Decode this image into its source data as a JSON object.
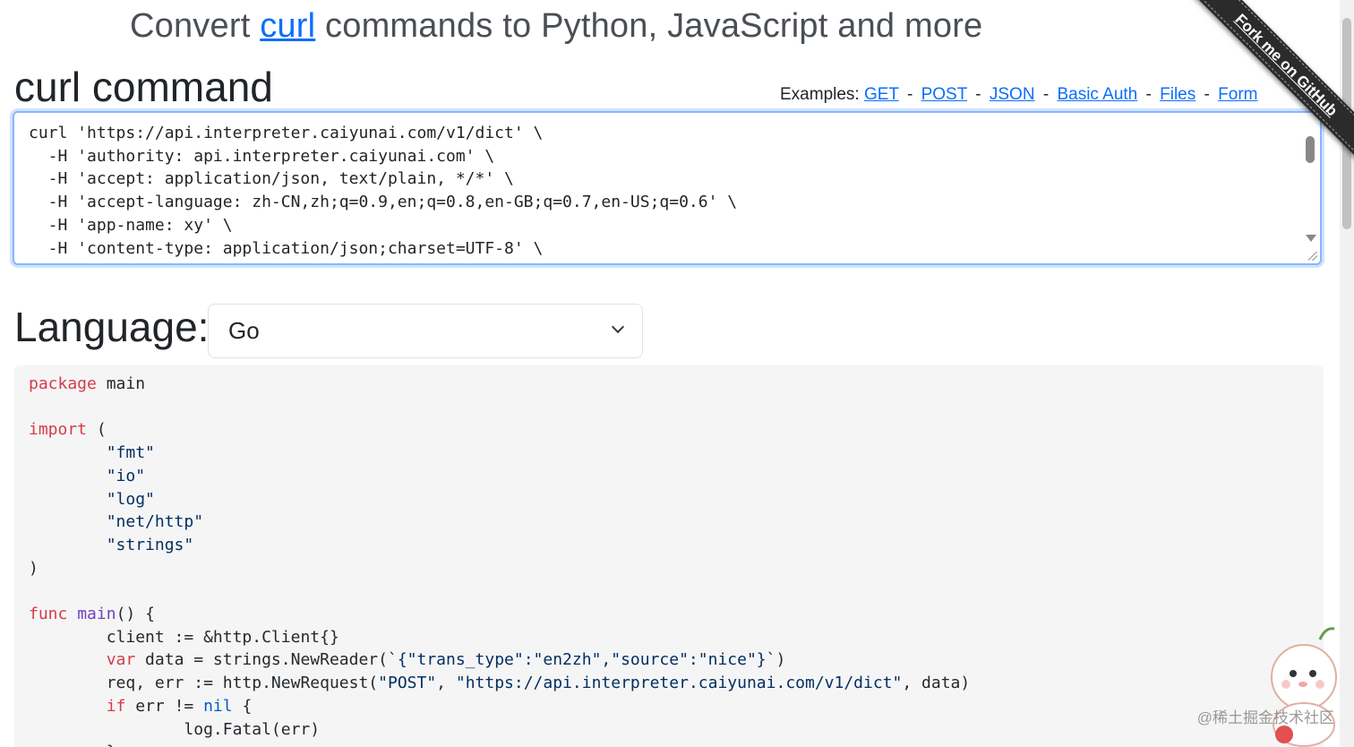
{
  "header": {
    "title_before": "Convert",
    "title_link": "curl",
    "title_after": "commands to Python, JavaScript and more"
  },
  "curl_section": {
    "heading": "curl command",
    "examples_label": "Examples:",
    "examples": [
      "GET",
      "POST",
      "JSON",
      "Basic Auth",
      "Files",
      "Form"
    ],
    "separator": "-",
    "command": "curl 'https://api.interpreter.caiyunai.com/v1/dict' \\\n  -H 'authority: api.interpreter.caiyunai.com' \\\n  -H 'accept: application/json, text/plain, */*' \\\n  -H 'accept-language: zh-CN,zh;q=0.9,en;q=0.8,en-GB;q=0.7,en-US;q=0.6' \\\n  -H 'app-name: xy' \\\n  -H 'content-type: application/json;charset=UTF-8' \\"
  },
  "language": {
    "label": "Language:",
    "selected": "Go"
  },
  "code": {
    "kw_package": "package",
    "pkg_name": " main",
    "kw_import": "import",
    "import_open": " (",
    "imports": [
      "\"fmt\"",
      "\"io\"",
      "\"log\"",
      "\"net/http\"",
      "\"strings\""
    ],
    "close_paren": ")",
    "kw_func": "func",
    "fn_main": "main",
    "main_rest": "() {",
    "line_client": "client := &http.Client{}",
    "kw_var": "var",
    "var_rest_a": " data = strings.NewReader(`",
    "raw_string": "{\"trans_type\":\"en2zh\",\"source\":\"nice\"}",
    "var_rest_b": "`)",
    "req_a": "req, err := http.NewRequest(",
    "req_method": "\"POST\"",
    "req_comma": ", ",
    "req_url": "\"https://api.interpreter.caiyunai.com/v1/dict\"",
    "req_b": ", data)",
    "kw_if": "if",
    "if_mid": " err != ",
    "lit_nil": "nil",
    "if_end": " {",
    "fatal": "log.Fatal(err)",
    "close_brace": "}"
  },
  "ribbon": {
    "text": "Fork me on GitHub"
  },
  "watermark": {
    "text": "@稀土掘金技术社区"
  },
  "colors": {
    "link": "#0d6efd",
    "keyword": "#d73a49",
    "function": "#6f42c1",
    "string": "#032f62",
    "literal": "#005cc5",
    "code_bg": "#f5f5f5",
    "focus_border": "#86b7fe"
  }
}
